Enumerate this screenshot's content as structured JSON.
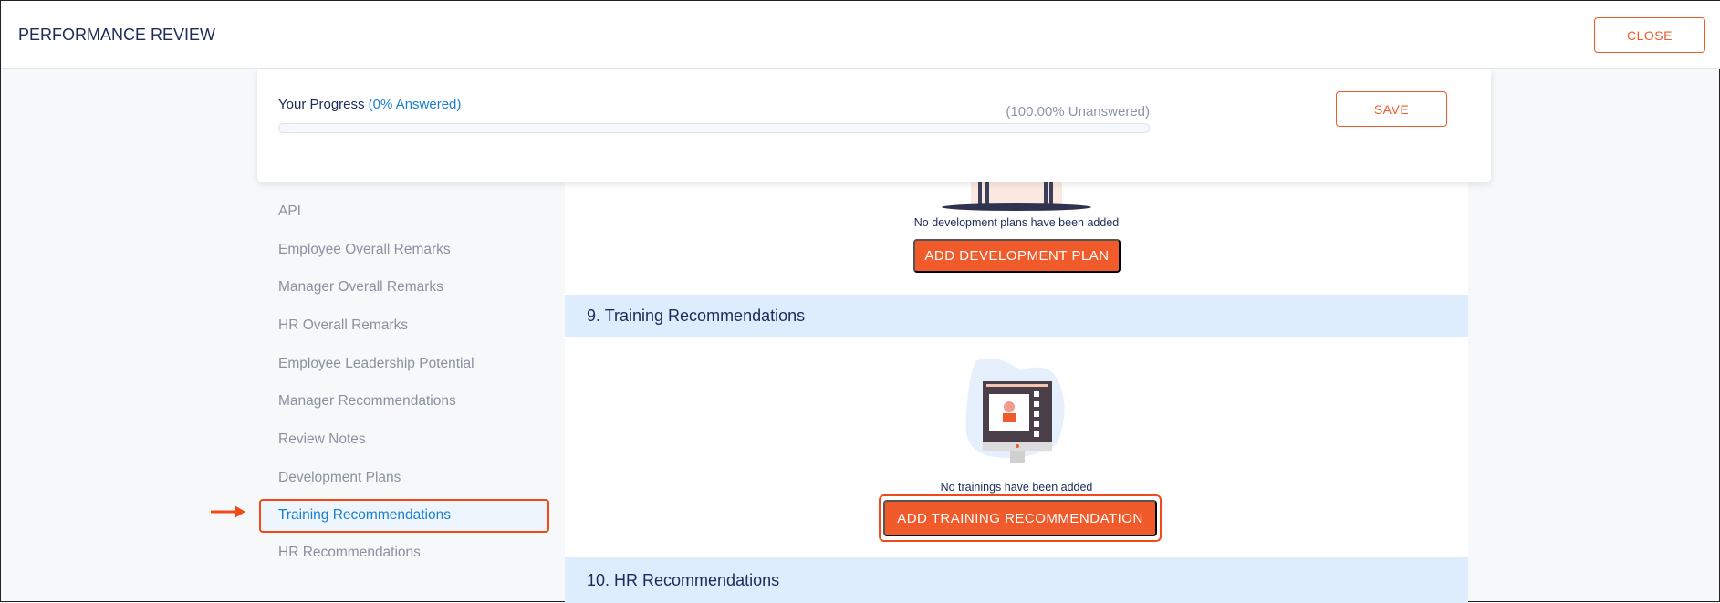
{
  "header": {
    "title": "PERFORMANCE REVIEW",
    "close_label": "CLOSE"
  },
  "progress": {
    "label": "Your Progress",
    "answered": "(0% Answered)",
    "unanswered": "(100.00% Unanswered)",
    "percent": 0,
    "save_label": "SAVE"
  },
  "sidebar": {
    "items": [
      {
        "label": "API"
      },
      {
        "label": "Employee Overall Remarks"
      },
      {
        "label": "Manager Overall Remarks"
      },
      {
        "label": "HR Overall Remarks"
      },
      {
        "label": "Employee Leadership Potential"
      },
      {
        "label": "Manager Recommendations"
      },
      {
        "label": "Review Notes"
      },
      {
        "label": "Development Plans"
      },
      {
        "label": "Training Recommendations",
        "active": true
      },
      {
        "label": "HR Recommendations"
      }
    ]
  },
  "main": {
    "dev_plans": {
      "empty_text": "No development plans have been added",
      "button": "ADD DEVELOPMENT PLAN"
    },
    "training": {
      "title": "9. Training Recommendations",
      "empty_text": "No trainings have been added",
      "button": "ADD TRAINING RECOMMENDATION"
    },
    "hr": {
      "title": "10. HR Recommendations"
    }
  },
  "colors": {
    "accent": "#f15a2b",
    "link": "#1a7fd0",
    "section": "#deedfd",
    "highlight": "#f04a1a"
  }
}
